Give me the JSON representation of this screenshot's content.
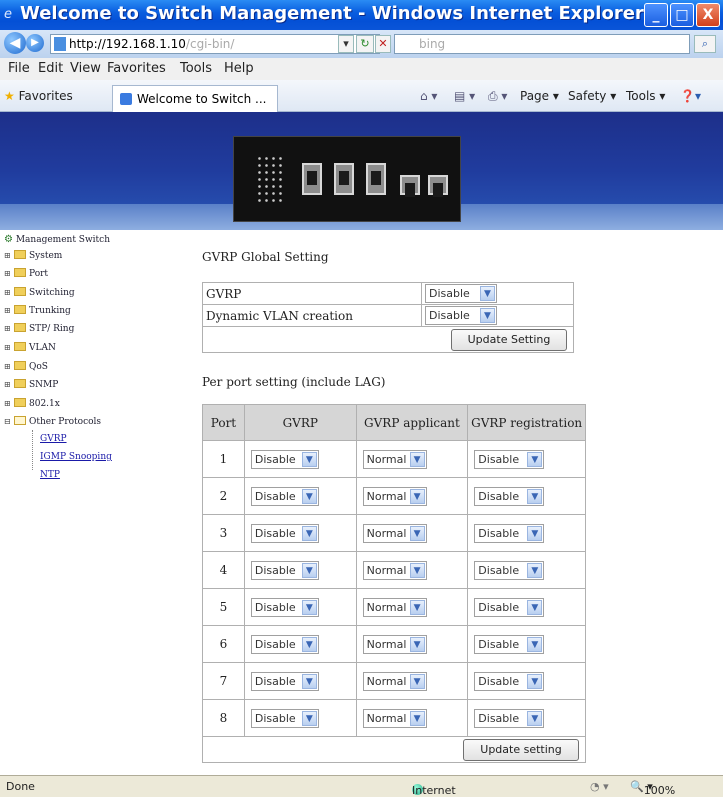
{
  "window": {
    "title": "Welcome to Switch Management - Windows Internet Explorer",
    "min_label": "_",
    "max_label": "□",
    "close_label": "X"
  },
  "address_bar": {
    "url": "http://192.168.1.10",
    "url_rest": "/cgi-bin/",
    "search_placeholder": "bing",
    "back_label": "◀",
    "forward_label": "▶"
  },
  "menu": [
    "File",
    "Edit",
    "View",
    "Favorites",
    "Tools",
    "Help"
  ],
  "favorites_bar": {
    "favorites_label": "Favorites",
    "tab_label": "Welcome to Switch ...",
    "page_label": "Page",
    "safety_label": "Safety",
    "tools_label": "Tools"
  },
  "sidebar": {
    "root": "Management Switch",
    "folders": [
      "System",
      "Port",
      "Switching",
      "Trunking",
      "STP/ Ring",
      "VLAN",
      "QoS",
      "SNMP",
      "802.1x"
    ],
    "open_folder": "Other Protocols",
    "links": [
      "GVRP",
      "IGMP Snooping",
      "NTP"
    ]
  },
  "global_setting": {
    "heading": "GVRP Global Setting",
    "rows": [
      {
        "label": "GVRP",
        "value": "Disable"
      },
      {
        "label": "Dynamic VLAN creation",
        "value": "Disable"
      }
    ],
    "update_label": "Update Setting"
  },
  "port_setting": {
    "heading": "Per port setting (include LAG)",
    "columns": [
      "Port",
      "GVRP",
      "GVRP applicant",
      "GVRP registration"
    ],
    "rows": [
      {
        "port": "1",
        "gvrp": "Disable",
        "applicant": "Normal",
        "registration": "Disable"
      },
      {
        "port": "2",
        "gvrp": "Disable",
        "applicant": "Normal",
        "registration": "Disable"
      },
      {
        "port": "3",
        "gvrp": "Disable",
        "applicant": "Normal",
        "registration": "Disable"
      },
      {
        "port": "4",
        "gvrp": "Disable",
        "applicant": "Normal",
        "registration": "Disable"
      },
      {
        "port": "5",
        "gvrp": "Disable",
        "applicant": "Normal",
        "registration": "Disable"
      },
      {
        "port": "6",
        "gvrp": "Disable",
        "applicant": "Normal",
        "registration": "Disable"
      },
      {
        "port": "7",
        "gvrp": "Disable",
        "applicant": "Normal",
        "registration": "Disable"
      },
      {
        "port": "8",
        "gvrp": "Disable",
        "applicant": "Normal",
        "registration": "Disable"
      }
    ],
    "update_label": "Update setting"
  },
  "status_bar": {
    "left": "Done",
    "zone": "Internet",
    "zoom": "100%"
  },
  "colors": {
    "titlebar": "#0a5fe0",
    "banner": "#1d2f8a",
    "table_header": "#d6d6d6",
    "link": "#1a1aa8"
  }
}
